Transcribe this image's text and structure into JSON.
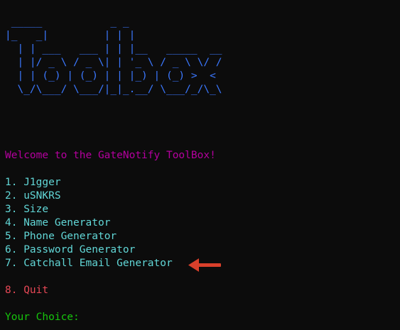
{
  "colors": {
    "background": "#0c0c0c",
    "banner": "#3b78ff",
    "welcome": "#b4009e",
    "menu": "#61d6d6",
    "quit": "#e74856",
    "prompt": "#16c60c",
    "arrow": "#d9402b"
  },
  "banner": {
    "ascii_art": " _____           _ _\n|_   _|         | | |\n  | | ___   ___ | | |__   _____  __\n  | |/ _ \\ / _ \\| | '_ \\ / _ \\ \\/ /\n  | | (_) | (_) | | |_) | (_) >  <\n  \\_/\\___/ \\___/|_|_.__/ \\___/_/\\_\\"
  },
  "welcome_text": "Welcome to the GateNotify ToolBox!",
  "menu": {
    "items": [
      {
        "number": "1.",
        "label": "J1gger"
      },
      {
        "number": "2.",
        "label": "uSNKRS"
      },
      {
        "number": "3.",
        "label": "Size"
      },
      {
        "number": "4.",
        "label": "Name Generator"
      },
      {
        "number": "5.",
        "label": "Phone Generator"
      },
      {
        "number": "6.",
        "label": "Password Generator"
      },
      {
        "number": "7.",
        "label": "Catchall Email Generator"
      }
    ],
    "quit": {
      "number": "8.",
      "label": "Quit"
    }
  },
  "prompt_text": "Your Choice:",
  "annotation": {
    "icon": "left-arrow-icon"
  }
}
